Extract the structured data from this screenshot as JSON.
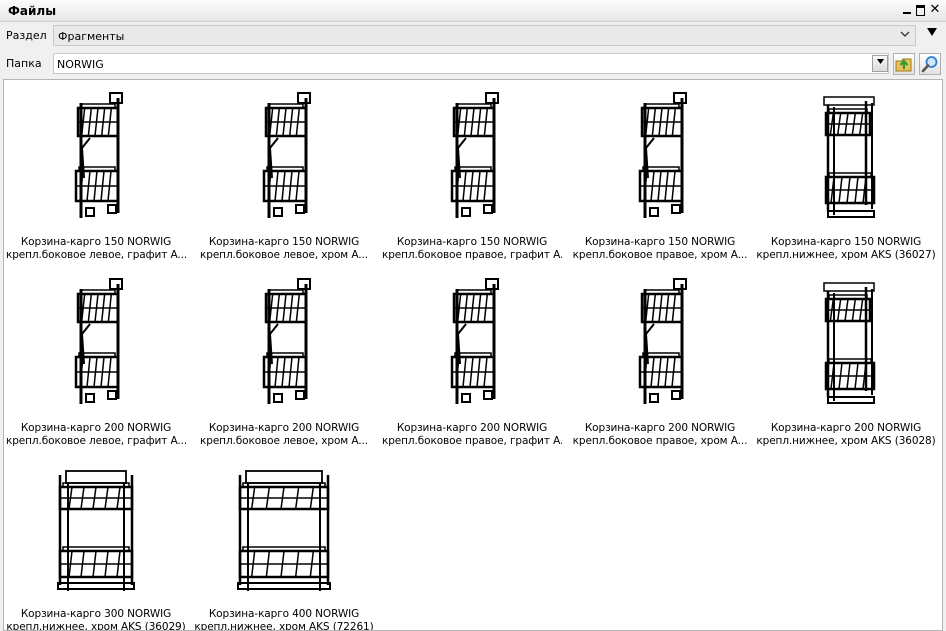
{
  "window": {
    "title": "Файлы"
  },
  "section": {
    "label": "Раздел",
    "value": "Фрагменты"
  },
  "folder": {
    "label": "Папка",
    "value": "NORWIG"
  },
  "colors": {
    "panel_bg": "#ffffff",
    "chrome_bg": "#f0f0f0",
    "icon_green": "#2f9e2f",
    "icon_blue": "#2f7fd0"
  },
  "icons": {
    "minimize": "minimize-icon",
    "maximize": "maximize-icon",
    "close": "close-icon",
    "menu": "dropdown-menu-icon",
    "up": "folder-up-icon",
    "search": "search-icon"
  },
  "items": [
    {
      "line1": "Корзина-карго 150 NORWIG",
      "line2": "крепл.боковое левое, графит A..."
    },
    {
      "line1": "Корзина-карго 150 NORWIG",
      "line2": "крепл.боковое левое, хром A..."
    },
    {
      "line1": "Корзина-карго 150 NORWIG",
      "line2": "крепл.боковое правое, графит A..."
    },
    {
      "line1": "Корзина-карго 150 NORWIG",
      "line2": "крепл.боковое правое, хром A..."
    },
    {
      "line1": "Корзина-карго 150 NORWIG",
      "line2": "крепл.нижнее, хром AKS (36027)"
    },
    {
      "line1": "Корзина-карго 200 NORWIG",
      "line2": "крепл.боковое левое, графит A..."
    },
    {
      "line1": "Корзина-карго 200 NORWIG",
      "line2": "крепл.боковое левое, хром A..."
    },
    {
      "line1": "Корзина-карго 200 NORWIG",
      "line2": "крепл.боковое правое, графит A..."
    },
    {
      "line1": "Корзина-карго 200 NORWIG",
      "line2": "крепл.боковое правое, хром A..."
    },
    {
      "line1": "Корзина-карго 200 NORWIG",
      "line2": "крепл.нижнее, хром AKS (36028)"
    },
    {
      "line1": "Корзина-карго 300 NORWIG",
      "line2": "крепл.нижнее, хром AKS (36029)"
    },
    {
      "line1": "Корзина-карго 400 NORWIG",
      "line2": "крепл.нижнее, хром AKS (72261)"
    }
  ]
}
